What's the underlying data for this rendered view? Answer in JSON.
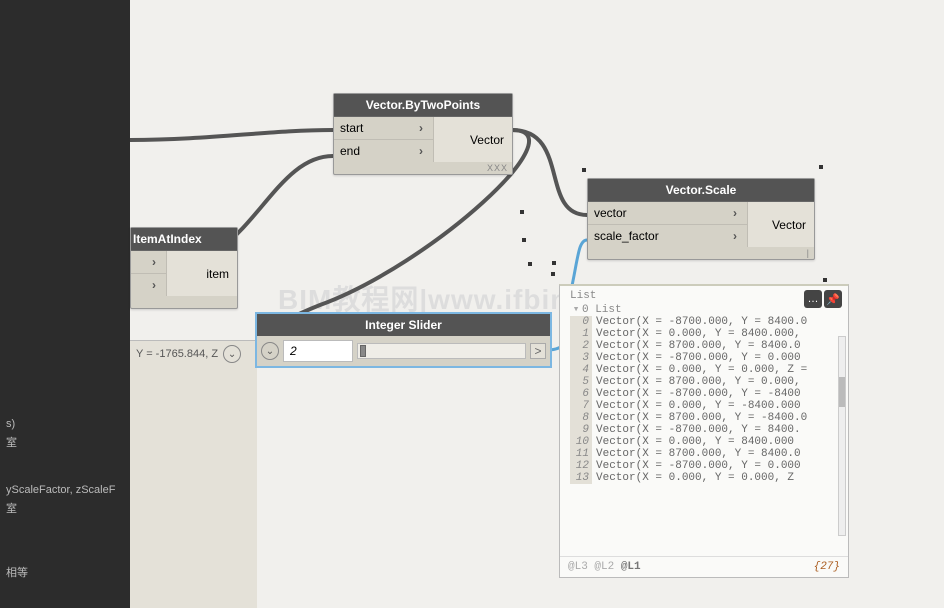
{
  "sidebar": {
    "text1": "s)",
    "text2": "室",
    "text3": "yScaleFactor, zScaleF",
    "text4": "室",
    "text5": "相等"
  },
  "status": {
    "coords": "Y = -1765.844, Z"
  },
  "nodes": {
    "bytwopoints": {
      "title": "Vector.ByTwoPoints",
      "in1": "start",
      "in2": "end",
      "out": "Vector",
      "footer": "XXX"
    },
    "scale": {
      "title": "Vector.Scale",
      "in1": "vector",
      "in2": "scale_factor",
      "out": "Vector"
    },
    "itematindex": {
      "title": "ItemAtIndex",
      "out": "item"
    },
    "slider": {
      "title": "Integer Slider",
      "value": "2",
      "arrow": ">"
    }
  },
  "output": {
    "head": "List",
    "sub": "0 List",
    "rows": [
      {
        "i": "0",
        "v": "Vector(X = -8700.000, Y = 8400.0"
      },
      {
        "i": "1",
        "v": "Vector(X = 0.000, Y = 8400.000,"
      },
      {
        "i": "2",
        "v": "Vector(X = 8700.000, Y = 8400.0"
      },
      {
        "i": "3",
        "v": "Vector(X = -8700.000, Y = 0.000"
      },
      {
        "i": "4",
        "v": "Vector(X = 0.000, Y = 0.000, Z ="
      },
      {
        "i": "5",
        "v": "Vector(X = 8700.000, Y = 0.000,"
      },
      {
        "i": "6",
        "v": "Vector(X = -8700.000, Y = -8400"
      },
      {
        "i": "7",
        "v": "Vector(X = 0.000, Y = -8400.000"
      },
      {
        "i": "8",
        "v": "Vector(X = 8700.000, Y = -8400.0"
      },
      {
        "i": "9",
        "v": "Vector(X = -8700.000, Y = 8400."
      },
      {
        "i": "10",
        "v": "Vector(X = 0.000, Y = 8400.000"
      },
      {
        "i": "11",
        "v": "Vector(X = 8700.000, Y = 8400.0"
      },
      {
        "i": "12",
        "v": "Vector(X = -8700.000, Y = 0.000"
      },
      {
        "i": "13",
        "v": "Vector(X = 0.000, Y = 0.000, Z"
      }
    ],
    "levels": "@L3 @L2",
    "levelbold": "@L1",
    "count": "{27}"
  },
  "watermark": "BIM教程网|www.ifbim.com"
}
